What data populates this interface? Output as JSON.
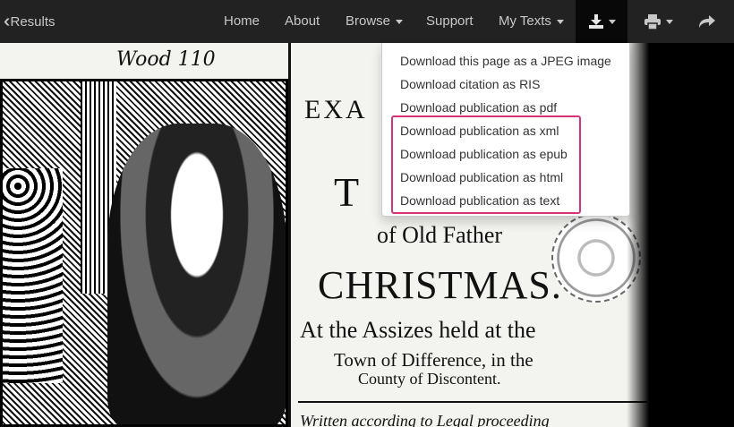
{
  "navbar": {
    "back_label": "Results",
    "items": [
      {
        "label": "Home"
      },
      {
        "label": "About"
      },
      {
        "label": "Browse"
      },
      {
        "label": "Support"
      },
      {
        "label": "My Texts"
      }
    ]
  },
  "download_menu": {
    "items": [
      {
        "label": "Download this page as a JPEG image"
      },
      {
        "label": "Download citation as RIS"
      },
      {
        "label": "Download publication as pdf"
      },
      {
        "label": "Download publication as xml"
      },
      {
        "label": "Download publication as epub"
      },
      {
        "label": "Download publication as html"
      },
      {
        "label": "Download publication as text"
      }
    ]
  },
  "page_image": {
    "handwritten_note": "Wood 110",
    "lines": [
      "EXA",
      "T",
      "of Old Father",
      "CHRISTMAS.",
      "At the Assizes held at the",
      "Town of Difference, in the",
      "County of Discontent.",
      "Written according to Legal proceeding"
    ]
  },
  "colors": {
    "navbar_bg": "#222222",
    "highlight": "#d6337a"
  },
  "icons": [
    "double-chevron-left-icon",
    "download-icon",
    "print-icon",
    "share-icon"
  ]
}
